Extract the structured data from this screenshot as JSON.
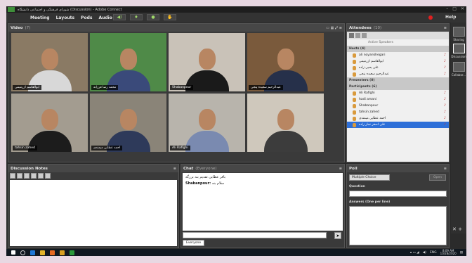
{
  "window": {
    "title": "شورای فرهنگی و اجتماعی دانشگاه (Discussion) - Adobe Connect"
  },
  "menu": {
    "items": [
      "Meeting",
      "Layouts",
      "Pods",
      "Audio"
    ],
    "help": "Help"
  },
  "video_pod": {
    "title": "Video",
    "count": "(7)",
    "tiles": [
      {
        "label": "ابوالقاسم ازرمیمی",
        "bg": "#8a7a64",
        "shirt": "#d8d8d8"
      },
      {
        "label": "محمد رضا فرزانه",
        "bg": "#4f8a48",
        "shirt": "#3a4a7a"
      },
      {
        "label": "Shabanpour",
        "bg": "#c9c2b8",
        "shirt": "#1a1a1a"
      },
      {
        "label": "عبدالرحیم سعیده پنجی",
        "bg": "#7a5a3c",
        "shirt": "#26304a"
      },
      {
        "label": "tahsin zahed",
        "bg": "#a39c90",
        "shirt": "#1c1c1c"
      },
      {
        "label": "احمد عطایی میمندی",
        "bg": "#8a8478",
        "shirt": "#2e3a5a"
      },
      {
        "label": "Ali Rafighi",
        "bg": "#b8b4ac",
        "shirt": "#7a8ab0"
      },
      {
        "label": "",
        "bg": "#cfc8bc",
        "shirt": "#3c3c3c"
      }
    ]
  },
  "notes_pod": {
    "title": "Discussion Notes"
  },
  "chat_pod": {
    "title": "Chat",
    "scope": "(Everyone)",
    "messages": [
      {
        "sender": "",
        "text": "باقر عطایی تقدیم بنه بزرگه"
      },
      {
        "sender": "Shabanpour:",
        "text": "سلام بنه"
      }
    ],
    "tab": "Everyone"
  },
  "attendees_pod": {
    "title": "Attendees",
    "count": "(10)",
    "active_speakers": "Active Speakers",
    "hosts_label": "Hosts (4)",
    "hosts": [
      "ali noyankhegari",
      "ابوالقاسم ازرمیمی",
      "علی یحیی زاده",
      "عبدالرحیم سعیده پنجی"
    ],
    "presenters_label": "Presenters (0)",
    "participants_label": "Participants (6)",
    "participants": [
      "Ali Rafighi",
      "hadi amani",
      "Shabanpour",
      "tahsin zahed",
      "احمد عطایی میمندی",
      "علی اصغر نجار زاده"
    ]
  },
  "poll_pod": {
    "title": "Poll",
    "type": "Multiple Choice",
    "open_button": "Open",
    "question_label": "Question",
    "answers_label": "Answers (One per line)"
  },
  "right_bar": {
    "items": [
      "Sharing",
      "Discussion",
      "Collabor..."
    ]
  },
  "taskbar": {
    "lang": "ENG",
    "time": "8:09 AM",
    "date": "10/28/2020"
  }
}
